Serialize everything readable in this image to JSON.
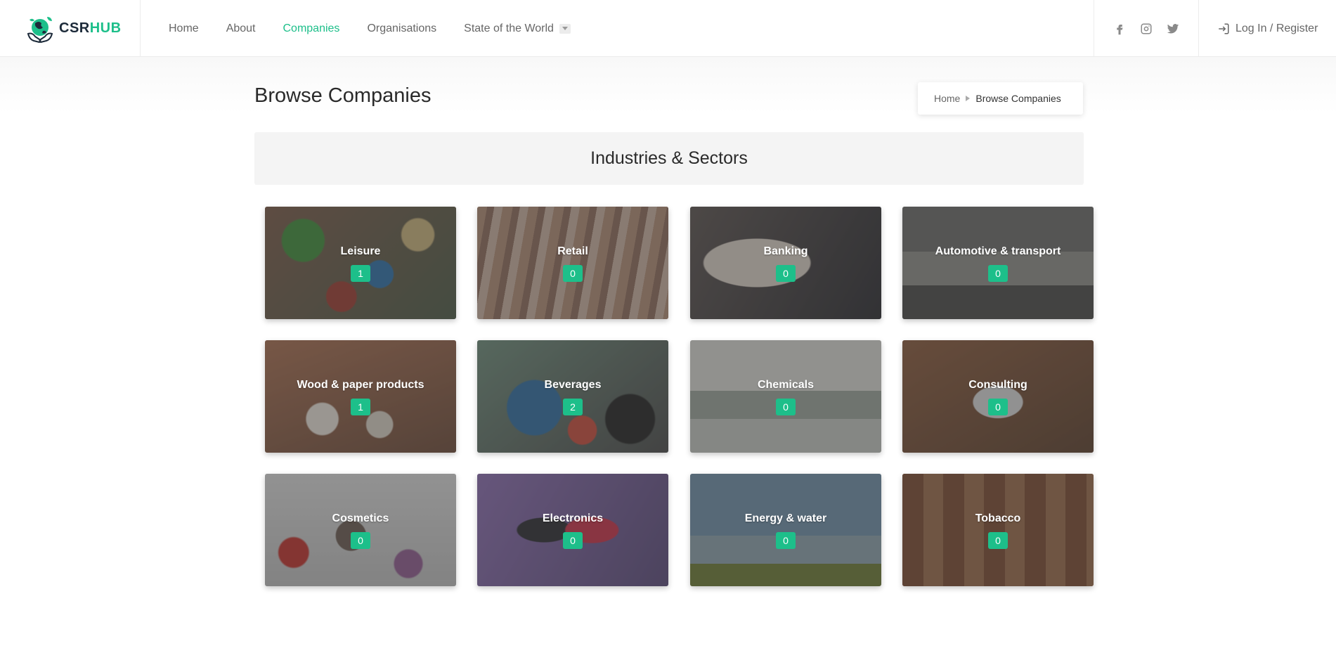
{
  "brand": {
    "name_part1": "CSR",
    "name_part2": "HUB"
  },
  "nav": {
    "items": [
      {
        "label": "Home",
        "active": false
      },
      {
        "label": "About",
        "active": false
      },
      {
        "label": "Companies",
        "active": true
      },
      {
        "label": "Organisations",
        "active": false
      },
      {
        "label": "State of the World",
        "active": false
      }
    ]
  },
  "social": [
    "facebook-icon",
    "instagram-icon",
    "twitter-icon"
  ],
  "login": {
    "label": "Log In / Register"
  },
  "page": {
    "title": "Browse Companies",
    "breadcrumb": {
      "home": "Home",
      "current": "Browse Companies"
    },
    "section_title": "Industries & Sectors"
  },
  "industries": [
    {
      "label": "Leisure",
      "count": "1"
    },
    {
      "label": "Retail",
      "count": "0"
    },
    {
      "label": "Banking",
      "count": "0"
    },
    {
      "label": "Automotive & transport",
      "count": "0"
    },
    {
      "label": "Wood & paper products",
      "count": "1"
    },
    {
      "label": "Beverages",
      "count": "2"
    },
    {
      "label": "Chemicals",
      "count": "0"
    },
    {
      "label": "Consulting",
      "count": "0"
    },
    {
      "label": "Cosmetics",
      "count": "0"
    },
    {
      "label": "Electronics",
      "count": "0"
    },
    {
      "label": "Energy & water",
      "count": "0"
    },
    {
      "label": "Tobacco",
      "count": "0"
    }
  ],
  "colors": {
    "accent": "#1dbf8a",
    "dark": "#1d2b3a"
  }
}
